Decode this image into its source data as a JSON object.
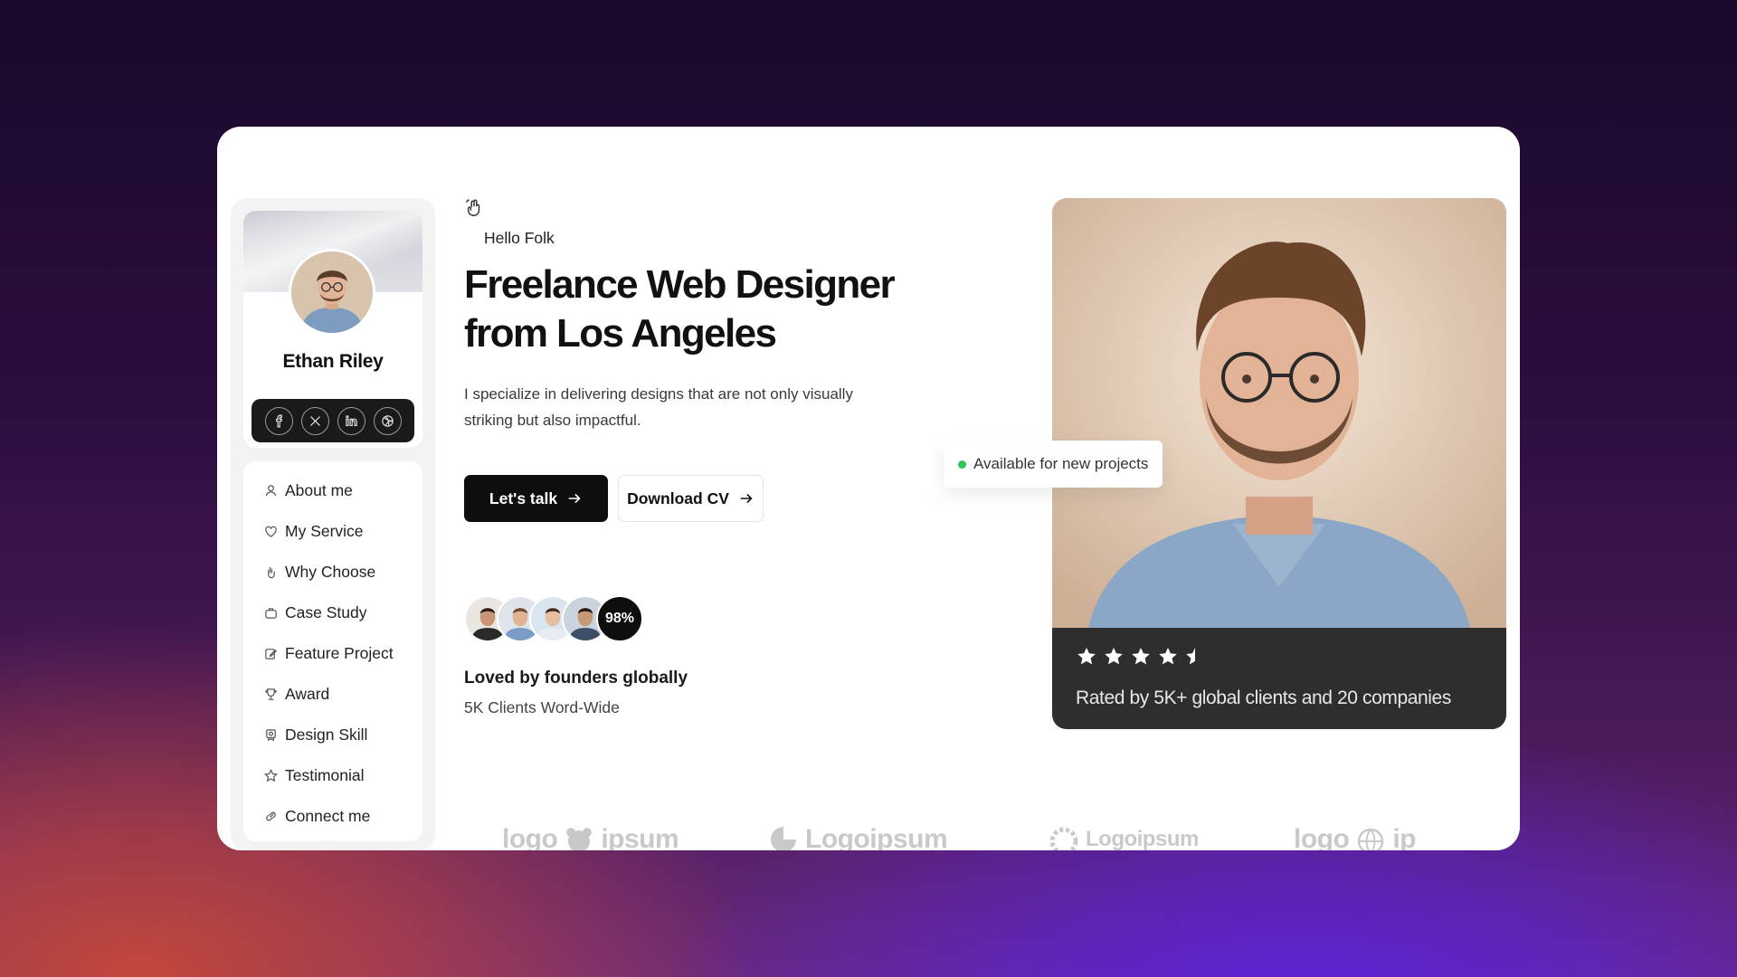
{
  "profile": {
    "name": "Ethan Riley",
    "social": [
      {
        "id": "facebook",
        "icon": "facebook-icon",
        "glyph": "f"
      },
      {
        "id": "x",
        "icon": "x-icon",
        "glyph": "X"
      },
      {
        "id": "linkedin",
        "icon": "linkedin-icon",
        "glyph": "in"
      },
      {
        "id": "dribbble",
        "icon": "dribbble-icon",
        "glyph": ""
      }
    ]
  },
  "nav": {
    "items": [
      {
        "label": "About me",
        "icon": "user-icon"
      },
      {
        "label": "My Service",
        "icon": "heart-icon"
      },
      {
        "label": "Why Choose",
        "icon": "hand-icon"
      },
      {
        "label": "Case Study",
        "icon": "briefcase-icon"
      },
      {
        "label": "Feature Project",
        "icon": "edit-icon"
      },
      {
        "label": "Award",
        "icon": "trophy-icon"
      },
      {
        "label": "Design Skill",
        "icon": "award-icon"
      },
      {
        "label": "Testimonial",
        "icon": "star-icon"
      },
      {
        "label": "Connect me",
        "icon": "link-icon"
      }
    ]
  },
  "hero": {
    "greeting": "Hello Folk",
    "headline_line1": "Freelance Web Designer",
    "headline_line2": "from Los Angeles",
    "description_line1": "I specialize in delivering designs that are not only visually",
    "description_line2": "striking but also impactful.",
    "primary_button": "Let's talk",
    "secondary_button": "Download CV"
  },
  "social_proof": {
    "percent": "98%",
    "title": "Loved by founders globally",
    "subtitle": "5K Clients Word-Wide"
  },
  "availability": {
    "label": "Available for new projects",
    "status_color": "#2ec65b"
  },
  "rating": {
    "stars": 4.5,
    "max_stars": 5,
    "text": "Rated by 5K+ global clients and 20 companies"
  },
  "logos": [
    {
      "text_left": "logo",
      "text_right": "ipsum"
    },
    {
      "text": "Logoipsum"
    },
    {
      "text": "Logoipsum"
    },
    {
      "text_left": "logo",
      "text_right": "ip"
    }
  ],
  "colors": {
    "accent": "#0e0e0e",
    "panel": "#2e2e2e"
  }
}
